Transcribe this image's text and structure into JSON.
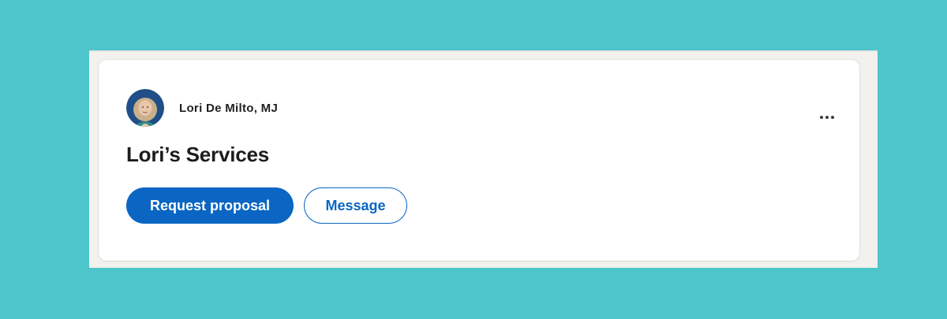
{
  "card": {
    "author_name": "Lori De Milto, MJ",
    "title": "Lori’s Services",
    "more_icon": "more-horizontal-icon"
  },
  "actions": {
    "primary_label": "Request proposal",
    "secondary_label": "Message"
  },
  "colors": {
    "background": "#4ec5ca",
    "backdrop": "#f3f1ed",
    "card": "#ffffff",
    "accent": "#0a66c2",
    "text": "#1c1c1c"
  }
}
